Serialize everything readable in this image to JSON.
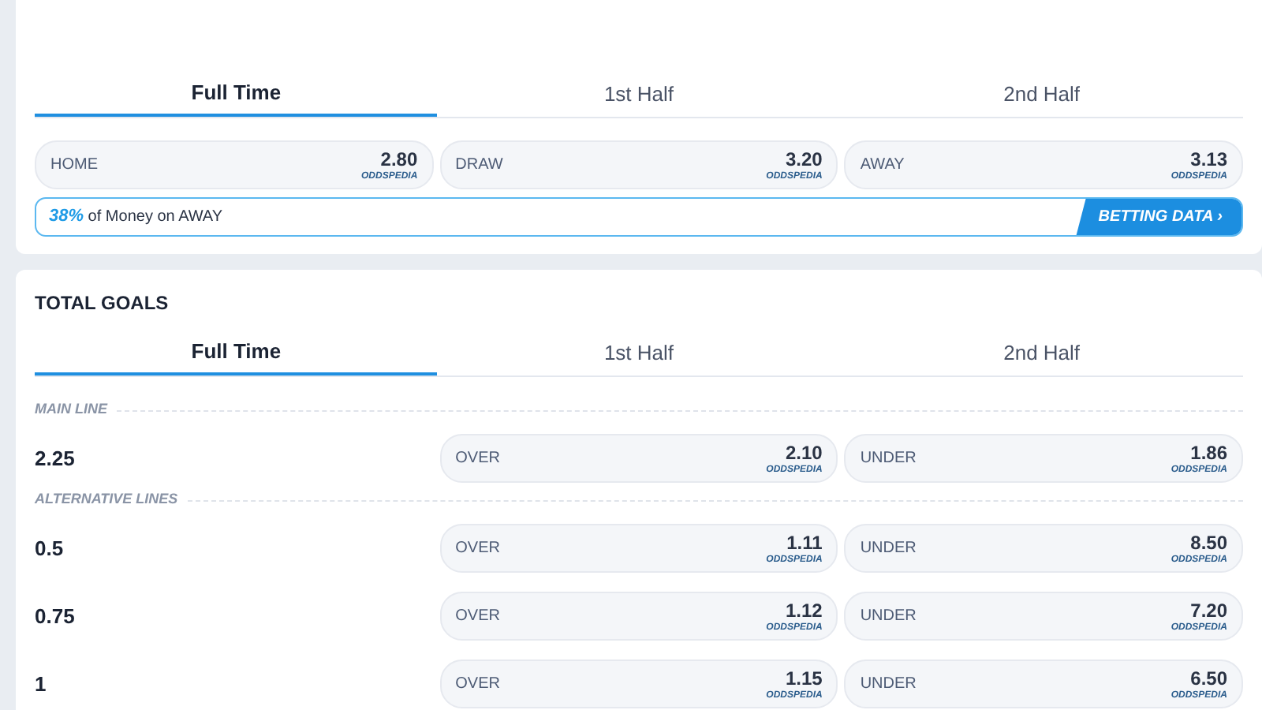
{
  "match_result": {
    "tabs": [
      {
        "label": "Full Time",
        "selected": true
      },
      {
        "label": "1st Half",
        "selected": false
      },
      {
        "label": "2nd Half",
        "selected": false
      }
    ],
    "odds": [
      {
        "label": "HOME",
        "price": "2.80",
        "provider": "ODDSPEDIA"
      },
      {
        "label": "DRAW",
        "price": "3.20",
        "provider": "ODDSPEDIA"
      },
      {
        "label": "AWAY",
        "price": "3.13",
        "provider": "ODDSPEDIA"
      }
    ],
    "money_bar": {
      "text": "**38%** of Money on AWAY",
      "button": "BETTING DATA ›"
    }
  },
  "total_goals": {
    "title": "TOTAL GOALS",
    "tabs": [
      {
        "label": "Full Time",
        "selected": true
      },
      {
        "label": "1st Half",
        "selected": false
      },
      {
        "label": "2nd Half",
        "selected": false
      }
    ],
    "sections": [
      {
        "heading": "MAIN LINE",
        "rows": [
          {
            "line": "2.25",
            "over": {
              "label": "OVER",
              "price": "2.10",
              "provider": "ODDSPEDIA"
            },
            "under": {
              "label": "UNDER",
              "price": "1.86",
              "provider": "ODDSPEDIA"
            }
          }
        ]
      },
      {
        "heading": "ALTERNATIVE LINES",
        "rows": [
          {
            "line": "0.5",
            "over": {
              "label": "OVER",
              "price": "1.11",
              "provider": "ODDSPEDIA"
            },
            "under": {
              "label": "UNDER",
              "price": "8.50",
              "provider": "ODDSPEDIA"
            }
          },
          {
            "line": "0.75",
            "over": {
              "label": "OVER",
              "price": "1.12",
              "provider": "ODDSPEDIA"
            },
            "under": {
              "label": "UNDER",
              "price": "7.20",
              "provider": "ODDSPEDIA"
            }
          },
          {
            "line": "1",
            "over": {
              "label": "OVER",
              "price": "1.15",
              "provider": "ODDSPEDIA"
            },
            "under": {
              "label": "UNDER",
              "price": "6.50",
              "provider": "ODDSPEDIA"
            }
          }
        ]
      }
    ]
  }
}
